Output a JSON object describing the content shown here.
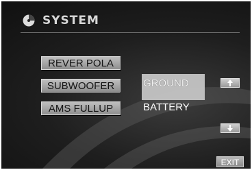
{
  "header": {
    "title": "SYSTEM",
    "icon": "system-disc-icon"
  },
  "menu": {
    "items": [
      {
        "label": "REVER POLA"
      },
      {
        "label": "SUBWOOFER"
      },
      {
        "label": "AMS FULLUP"
      }
    ]
  },
  "options": {
    "selected": "GROUND",
    "alternate": "BATTERY"
  },
  "controls": {
    "up_icon": "arrow-up-icon",
    "down_icon": "arrow-down-icon",
    "exit_label": "EXIT"
  }
}
